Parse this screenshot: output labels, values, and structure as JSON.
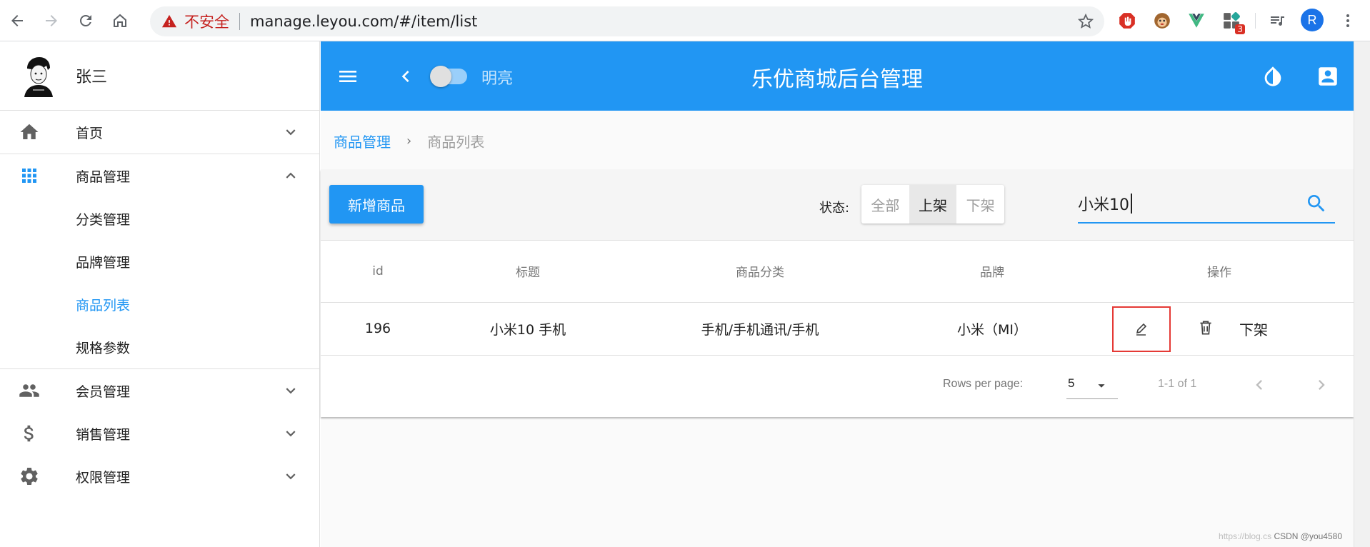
{
  "browser": {
    "security_label": "不安全",
    "url": "manage.leyou.com/#/item/list",
    "ext_badge": "3",
    "profile_initial": "R"
  },
  "sidebar": {
    "user_name": "张三",
    "items": [
      {
        "label": "首页",
        "icon": "home-icon"
      },
      {
        "label": "商品管理",
        "icon": "apps-icon",
        "expanded": true,
        "children": [
          {
            "label": "分类管理"
          },
          {
            "label": "品牌管理"
          },
          {
            "label": "商品列表",
            "active": true
          },
          {
            "label": "规格参数"
          }
        ]
      },
      {
        "label": "会员管理",
        "icon": "people-icon"
      },
      {
        "label": "销售管理",
        "icon": "dollar-icon"
      },
      {
        "label": "权限管理",
        "icon": "gear-icon"
      }
    ]
  },
  "appbar": {
    "mode_label": "明亮",
    "title": "乐优商城后台管理"
  },
  "breadcrumb": {
    "parent": "商品管理",
    "current": "商品列表"
  },
  "toolbar": {
    "add_label": "新增商品",
    "status_label": "状态:",
    "status_options": [
      "全部",
      "上架",
      "下架"
    ],
    "status_selected": "上架",
    "search_value": "小米10"
  },
  "table": {
    "headers": [
      "id",
      "标题",
      "商品分类",
      "品牌",
      "操作"
    ],
    "rows": [
      {
        "id": "196",
        "title": "小米10 手机",
        "category": "手机/手机通讯/手机",
        "brand": "小米（MI）",
        "offshelf_label": "下架"
      }
    ]
  },
  "pagination": {
    "rows_per_page_label": "Rows per page:",
    "rows_per_page": "5",
    "range": "1-1 of 1"
  },
  "watermark": {
    "url": "https://blog.cs",
    "author": "CSDN @you4580"
  },
  "colors": {
    "primary": "#2196f3",
    "highlight_box": "#e53935",
    "insecure": "#c5221f"
  }
}
